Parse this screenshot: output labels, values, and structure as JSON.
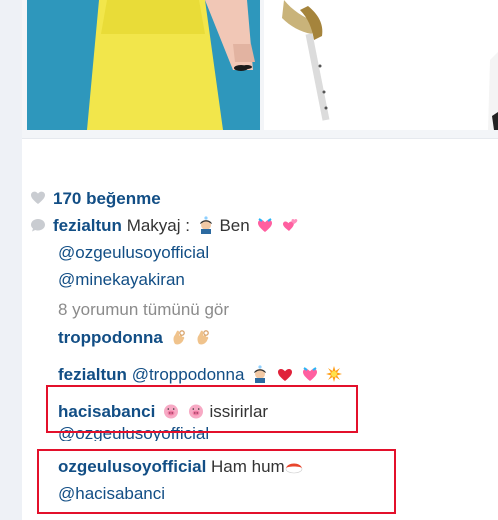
{
  "post": {
    "likes": "170 beğenme"
  },
  "caption": {
    "username": "fezialtun",
    "text": "Makyaj :",
    "text2": "Ben",
    "mentions": [
      "@ozgeulusoyofficial",
      "@minekayakiran"
    ]
  },
  "view_all_comments": "8 yorumun tümünü gör",
  "comments": [
    {
      "username": "troppodonna",
      "text": ""
    },
    {
      "username": "fezialtun",
      "text": "@troppodonna"
    },
    {
      "username": "hacisabanci",
      "text": "issirirlar",
      "mention": "@ozgeulusoyofficial"
    },
    {
      "username": "ozgeulusoyofficial",
      "text": "Ham hum",
      "mention": "@hacisabanci"
    }
  ],
  "colors": {
    "link": "#124e85",
    "highlight_box": "#e3102b",
    "photo_bg": "#2b8fb4"
  },
  "icons": [
    "heart-icon",
    "comment-bubble-icon"
  ]
}
